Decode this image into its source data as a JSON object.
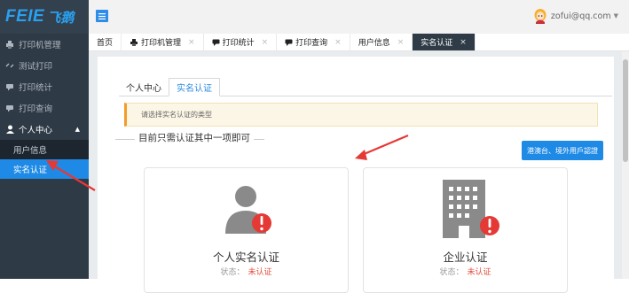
{
  "logo": {
    "brand": "FEIE",
    "brand_cn": "飞鹅"
  },
  "sidebar": {
    "items": [
      {
        "label": "打印机管理",
        "icon": "printer-icon"
      },
      {
        "label": "测试打印",
        "icon": "link-icon"
      },
      {
        "label": "打印统计",
        "icon": "chat-icon"
      },
      {
        "label": "打印查询",
        "icon": "chat-icon"
      },
      {
        "label": "个人中心",
        "icon": "user-icon"
      }
    ],
    "sub_items": [
      {
        "label": "用户信息"
      },
      {
        "label": "实名认证"
      }
    ]
  },
  "header": {
    "user_email": "zofui@qq.com"
  },
  "tabs": [
    {
      "label": "首页"
    },
    {
      "label": "打印机管理"
    },
    {
      "label": "打印统计"
    },
    {
      "label": "打印查询"
    },
    {
      "label": "用户信息"
    },
    {
      "label": "实名认证"
    }
  ],
  "main": {
    "subtabs": [
      {
        "label": "个人中心"
      },
      {
        "label": "实名认证"
      }
    ],
    "alert_text": "请选择实名认证的类型",
    "section_title": "目前只需认证其中一项即可",
    "hk_button": "港澳台、境外用戶認證",
    "cards": [
      {
        "title": "个人实名认证",
        "status_label": "状态：",
        "status_value": "未认证",
        "icon": "person-alert-icon"
      },
      {
        "title": "企业认证",
        "status_label": "状态：",
        "status_value": "未认证",
        "icon": "building-alert-icon"
      }
    ]
  },
  "colors": {
    "sidebar_bg": "#2e3a46",
    "accent_blue": "#1e8ae6",
    "alert_orange": "#f39c28",
    "status_red": "#e54c3c",
    "annotation_red": "#e53935"
  }
}
